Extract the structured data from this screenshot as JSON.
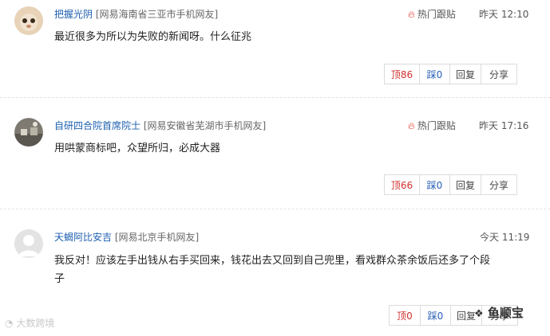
{
  "comments": [
    {
      "user": "把握光阴",
      "location": "[网易海南省三亚市手机网友]",
      "hot_label": "热门跟贴",
      "time": "昨天 12:10",
      "text": "最近很多为所以为失败的新闻呀。什么征兆",
      "actions": {
        "up": "顶86",
        "down": "踩0",
        "reply": "回复",
        "share": "分享"
      }
    },
    {
      "user": "自研四合院首席院士",
      "location": "[网易安徽省芜湖市手机网友]",
      "hot_label": "热门跟贴",
      "time": "昨天 17:16",
      "text": "用哄蒙商标吧，众望所归，必成大器",
      "actions": {
        "up": "顶66",
        "down": "踩0",
        "reply": "回复",
        "share": "分享"
      }
    },
    {
      "user": "天蝎阿比安吉",
      "location": "[网易北京手机网友]",
      "time": "今天 11:19",
      "text_line1": "我反对！应该左手出钱从右手买回来，钱花出去又回到自己兜里，看戏群众茶余饭后还多了个段",
      "text_line2": "子",
      "actions": {
        "up": "顶0",
        "down": "踩0",
        "reply": "回复",
        "share": "分享"
      }
    }
  ],
  "watermark_left": "大数跨境",
  "watermark_right": "鱼顺宝",
  "icons": [
    "flame-icon",
    "avatar",
    "camera-icon",
    "wechat-icon"
  ]
}
